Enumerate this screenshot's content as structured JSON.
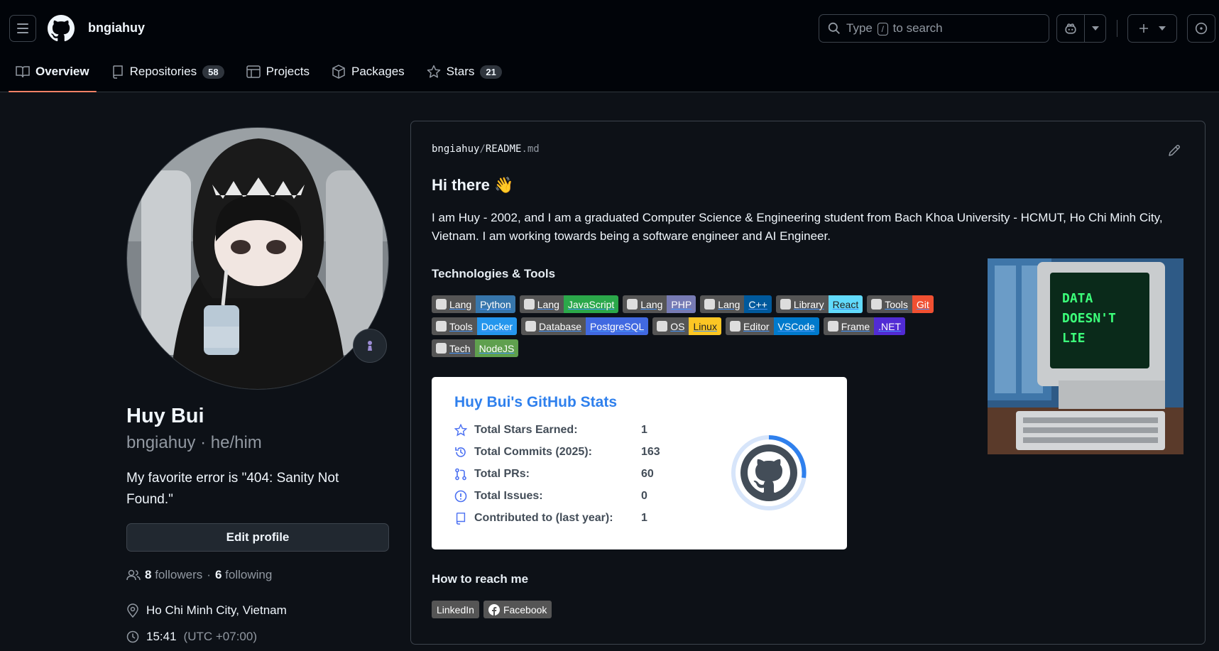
{
  "header": {
    "username": "bngiahuy",
    "search_prefix": "Type",
    "search_key": "/",
    "search_suffix": "to search"
  },
  "tabs": [
    {
      "label": "Overview",
      "icon": "book-icon",
      "active": true
    },
    {
      "label": "Repositories",
      "icon": "repo-icon",
      "count": "58"
    },
    {
      "label": "Projects",
      "icon": "table-icon"
    },
    {
      "label": "Packages",
      "icon": "package-icon"
    },
    {
      "label": "Stars",
      "icon": "star-icon",
      "count": "21"
    }
  ],
  "profile": {
    "name": "Huy Bui",
    "nick": "bngiahuy · he/him",
    "bio": "My favorite error is \"404: Sanity Not Found.\"",
    "edit_label": "Edit profile",
    "followers_count": "8",
    "followers_label": "followers",
    "sep": "·",
    "following_count": "6",
    "following_label": "following",
    "location": "Ho Chi Minh City, Vietnam",
    "time": "15:41",
    "tz": "(UTC +07:00)"
  },
  "readme": {
    "owner": "bngiahuy",
    "slash": "/",
    "file": "README",
    "ext": ".md",
    "greeting": "Hi there 👋",
    "intro": "I am Huy - 2002, and I am a graduated Computer Science & Engineering student from Bach Khoa University - HCMUT, Ho Chi Minh City, Vietnam. I am working towards being a software engineer and AI Engineer.",
    "tech_heading": "Technologies & Tools",
    "badges": [
      {
        "left": "Lang",
        "right": "Python",
        "color": "#3776AB"
      },
      {
        "left": "Lang",
        "right": "JavaScript",
        "color": "#2BA84A"
      },
      {
        "left": "Lang",
        "right": "PHP",
        "color": "#777BB4"
      },
      {
        "left": "Lang",
        "right": "C++",
        "color": "#00599C"
      },
      {
        "left": "Library",
        "right": "React",
        "color": "#61DAFB"
      },
      {
        "left": "Tools",
        "right": "Git",
        "color": "#F05032"
      },
      {
        "left": "Tools",
        "right": "Docker",
        "color": "#2496ED"
      },
      {
        "left": "Database",
        "right": "PostgreSQL",
        "color": "#4169E1"
      },
      {
        "left": "OS",
        "right": "Linux",
        "color": "#FCC624"
      },
      {
        "left": "Editor",
        "right": "VSCode",
        "color": "#007ACC"
      },
      {
        "left": "Frame",
        "right": ".NET",
        "color": "#512BD4"
      },
      {
        "left": "Tech",
        "right": "NodeJS",
        "color": "#5FA04E"
      }
    ],
    "stats": {
      "title": "Huy Bui's GitHub Stats",
      "rows": [
        {
          "label": "Total Stars Earned:",
          "value": "1",
          "icon": "star-icon"
        },
        {
          "label": "Total Commits (2025):",
          "value": "163",
          "icon": "history-icon"
        },
        {
          "label": "Total PRs:",
          "value": "60",
          "icon": "pull-request-icon"
        },
        {
          "label": "Total Issues:",
          "value": "0",
          "icon": "issue-icon"
        },
        {
          "label": "Contributed to (last year):",
          "value": "1",
          "icon": "repo-icon"
        }
      ]
    },
    "reach_heading": "How to reach me",
    "reach": [
      {
        "label": "LinkedIn"
      },
      {
        "label": "Facebook"
      }
    ],
    "retro_text": [
      "DATA",
      "DOESN'T",
      "LIE"
    ]
  }
}
